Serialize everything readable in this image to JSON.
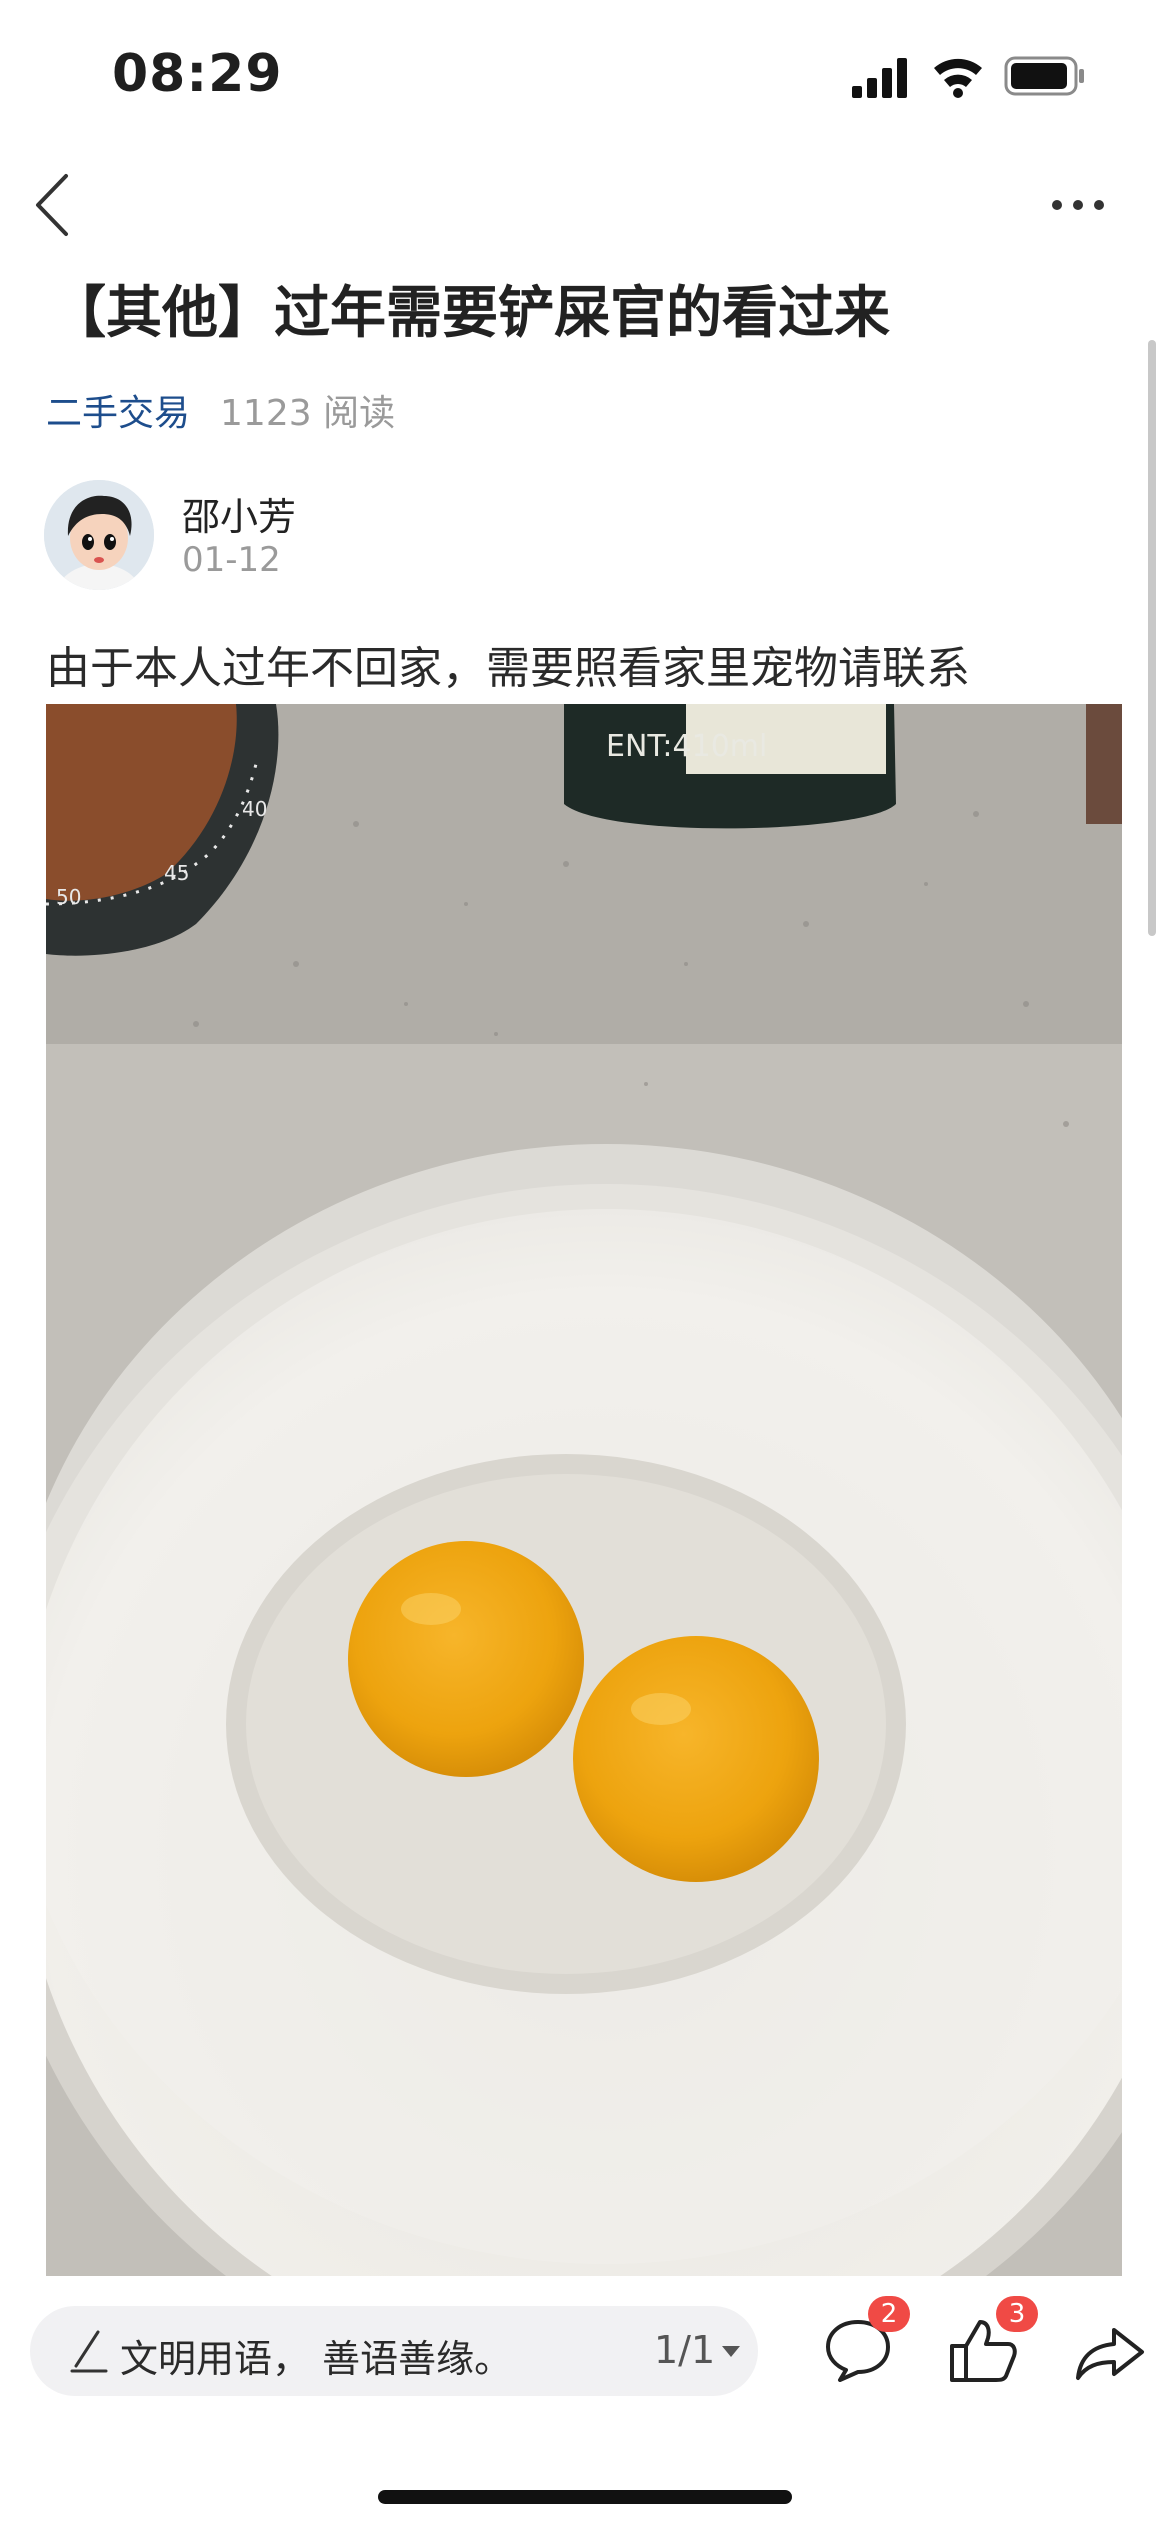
{
  "status_bar": {
    "time": "08:29"
  },
  "post": {
    "title": "【其他】过年需要铲屎官的看过来",
    "category": "二手交易",
    "views": "1123 阅读",
    "author": "邵小芳",
    "date": "01-12",
    "content": "由于本人过年不回家，需要照看家里宠物请联系",
    "photo": {
      "bottle_label": "ENT:410ml",
      "timer_marks": [
        "50",
        "45",
        "40"
      ]
    }
  },
  "bottom_bar": {
    "comment_placeholder": "文明用语， 善语善缘。",
    "pager": "1/1",
    "comment_count": "2",
    "like_count": "3"
  },
  "colors": {
    "accent": "#1d4d8c",
    "badge": "#f04a45"
  },
  "icons": [
    "signal-icon",
    "wifi-icon",
    "battery-icon",
    "back-arrow-icon",
    "more-icon",
    "pen-icon",
    "chevron-down-icon",
    "comment-icon",
    "thumbs-up-icon",
    "share-icon"
  ]
}
